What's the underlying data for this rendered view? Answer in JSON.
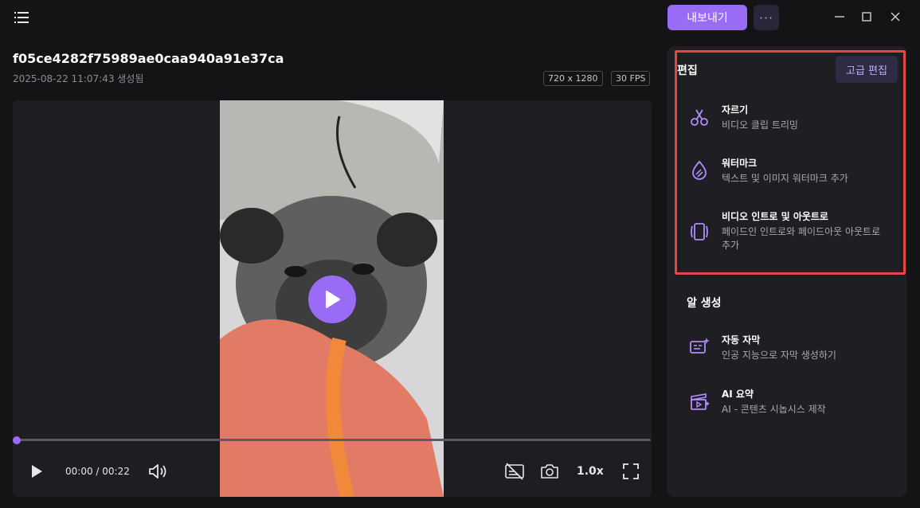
{
  "header": {
    "export_label": "내보내기",
    "more_label": "···"
  },
  "file": {
    "title": "f05ce4282f75989ae0caa940a91e37ca",
    "created": "2025-08-22 11:07:43 생성됨",
    "resolution": "720 x 1280",
    "fps": "30 FPS"
  },
  "player": {
    "time": "00:00 / 00:22",
    "speed": "1.0x",
    "progress": 0
  },
  "edit_section": {
    "title": "편집",
    "advanced_label": "고급 편집",
    "items": [
      {
        "name": "자르기",
        "desc": "비디오 클립 트리밍",
        "icon": "scissors-icon"
      },
      {
        "name": "워터마크",
        "desc": "텍스트 및 이미지 워터마크 추가",
        "icon": "watermark-drop-icon"
      },
      {
        "name": "비디오 인트로 및 아웃트로",
        "desc": "페이드인 인트로와 페이드아웃 아웃트로 추가",
        "icon": "intro-outro-icon"
      }
    ]
  },
  "ai_section": {
    "title": "알 생성",
    "items": [
      {
        "name": "자동 자막",
        "desc": "인공 지능으로 자막 생성하기",
        "icon": "auto-subtitle-icon"
      },
      {
        "name": "AI 요약",
        "desc": "AI - 콘텐츠 시놉시스 제작",
        "icon": "ai-summary-icon"
      }
    ]
  },
  "colors": {
    "accent": "#9a6bf5",
    "highlight_border": "#e64545",
    "background": "#141416",
    "panel": "#1f1f23"
  }
}
